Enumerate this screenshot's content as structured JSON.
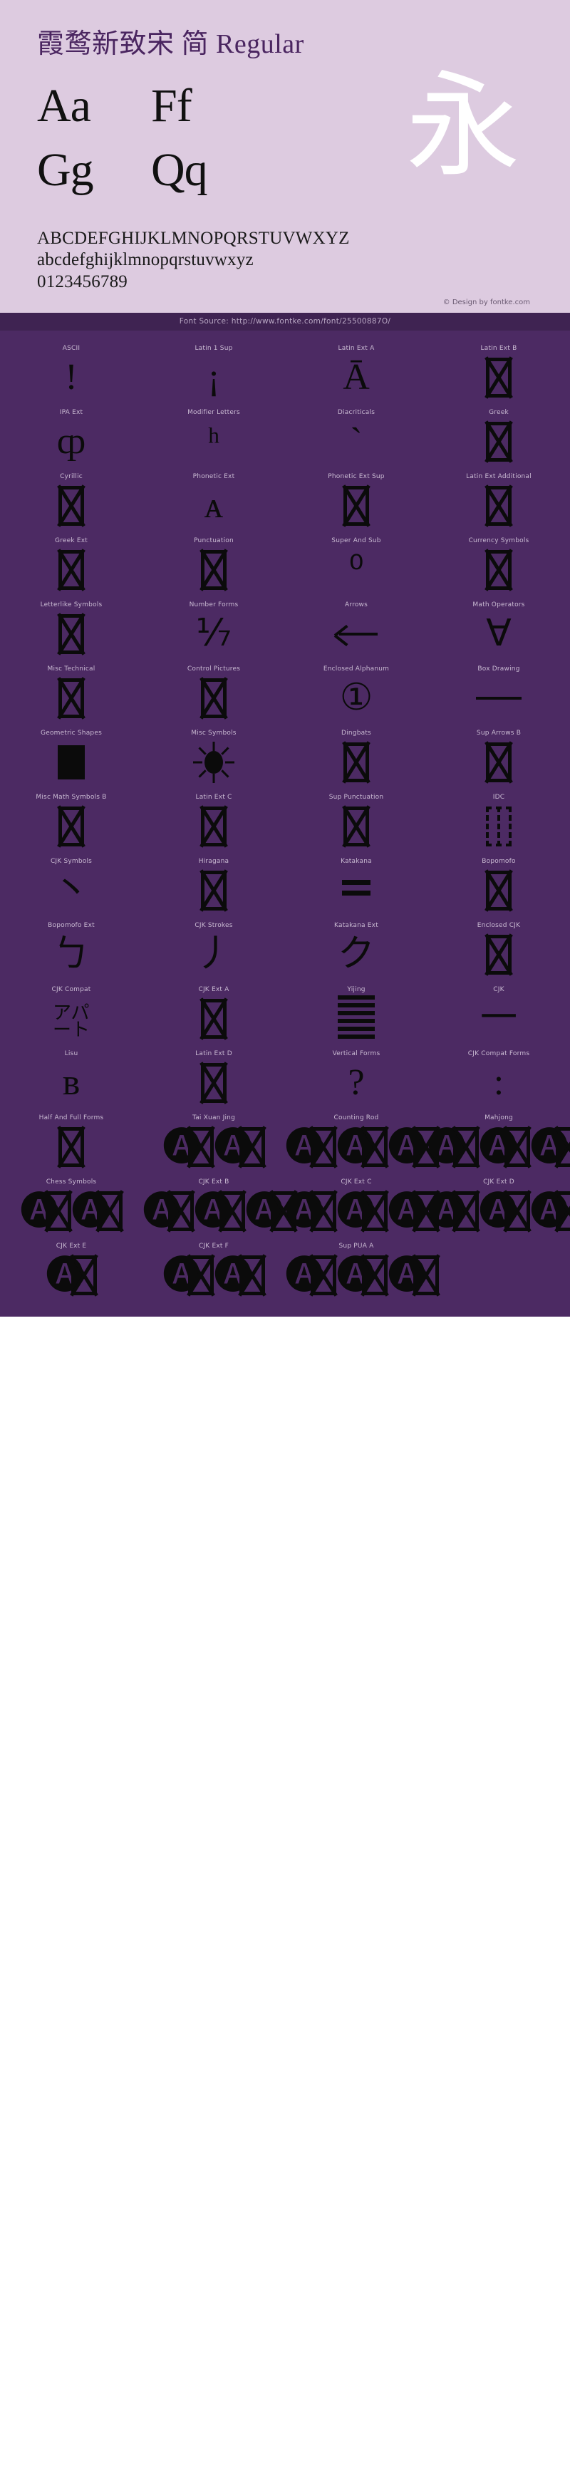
{
  "header": {
    "font_title": "霞鹜新致宋 简 Regular",
    "sample_pairs": [
      "Aa",
      "Ff",
      "Gg",
      "Qq"
    ],
    "cjk_showcase_glyph": "永",
    "uppercase_line": "ABCDEFGHIJKLMNOPQRSTUVWXYZ",
    "lowercase_line": "abcdefghijklmnopqrstuvwxyz",
    "digits_line": "0123456789",
    "design_credit": "© Design by fontke.com",
    "font_source": "Font Source: http://www.fontke.com/font/25500887O/"
  },
  "colors": {
    "specimen_background": "#ddcbe0",
    "title_color": "#4a2560",
    "grid_background": "#4c2a63",
    "source_bar_background": "#3f2352",
    "glyph_color": "#0b0b0b",
    "label_color": "#c9bad2"
  },
  "unicode_blocks": [
    {
      "label": "ASCII",
      "sample": "!"
    },
    {
      "label": "Latin 1 Sup",
      "sample": "¡"
    },
    {
      "label": "Latin Ext A",
      "sample": "Ā"
    },
    {
      "label": "Latin Ext B",
      "sample": "tofu"
    },
    {
      "label": "IPA Ext",
      "sample": "ȹ"
    },
    {
      "label": "Modifier Letters",
      "sample": "ʰ"
    },
    {
      "label": "Diacriticals",
      "sample": "`"
    },
    {
      "label": "Greek",
      "sample": "tofu"
    },
    {
      "label": "Cyrillic",
      "sample": "tofu"
    },
    {
      "label": "Phonetic Ext",
      "sample": "ᴀ"
    },
    {
      "label": "Phonetic Ext Sup",
      "sample": "tofu"
    },
    {
      "label": "Latin Ext Additional",
      "sample": "tofu"
    },
    {
      "label": "Greek Ext",
      "sample": "tofu"
    },
    {
      "label": "Punctuation",
      "sample": "tofu"
    },
    {
      "label": "Super And Sub",
      "sample": "⁰"
    },
    {
      "label": "Currency Symbols",
      "sample": "tofu"
    },
    {
      "label": "Letterlike Symbols",
      "sample": "tofu"
    },
    {
      "label": "Number Forms",
      "sample": "⅐"
    },
    {
      "label": "Arrows",
      "sample": "arrow-left"
    },
    {
      "label": "Math Operators",
      "sample": "∀"
    },
    {
      "label": "Misc Technical",
      "sample": "tofu"
    },
    {
      "label": "Control Pictures",
      "sample": "tofu"
    },
    {
      "label": "Enclosed Alphanum",
      "sample": "①"
    },
    {
      "label": "Box Drawing",
      "sample": "bar"
    },
    {
      "label": "Geometric Shapes",
      "sample": "solid-square"
    },
    {
      "label": "Misc Symbols",
      "sample": "sun"
    },
    {
      "label": "Dingbats",
      "sample": "tofu"
    },
    {
      "label": "Sup Arrows B",
      "sample": "tofu"
    },
    {
      "label": "Misc Math Symbols B",
      "sample": "tofu"
    },
    {
      "label": "Latin Ext C",
      "sample": "tofu"
    },
    {
      "label": "Sup Punctuation",
      "sample": "tofu"
    },
    {
      "label": "IDC",
      "sample": "tofu-dashed"
    },
    {
      "label": "CJK Symbols",
      "sample": "丶"
    },
    {
      "label": "Hiragana",
      "sample": "tofu"
    },
    {
      "label": "Katakana",
      "sample": "dbl-eq"
    },
    {
      "label": "Bopomofo",
      "sample": "tofu"
    },
    {
      "label": "Bopomofo Ext",
      "sample": "ㄅ"
    },
    {
      "label": "CJK Strokes",
      "sample": "丿"
    },
    {
      "label": "Katakana Ext",
      "sample": "ク"
    },
    {
      "label": "Enclosed CJK",
      "sample": "tofu"
    },
    {
      "label": "CJK Compat",
      "sample": "アパート"
    },
    {
      "label": "CJK Ext A",
      "sample": "tofu"
    },
    {
      "label": "Yijing",
      "sample": "hexagram"
    },
    {
      "label": "CJK",
      "sample": "一"
    },
    {
      "label": "Lisu",
      "sample": "ʙ"
    },
    {
      "label": "Latin Ext D",
      "sample": "tofu"
    },
    {
      "label": "Vertical Forms",
      "sample": "?"
    },
    {
      "label": "CJK Compat Forms",
      "sample": ":"
    },
    {
      "label": "Half And Full Forms",
      "sample": "tofu"
    },
    {
      "label": "Tai Xuan Jing",
      "sample": "cluster-2"
    },
    {
      "label": "Counting Rod",
      "sample": "cluster-3"
    },
    {
      "label": "Mahjong",
      "sample": "cluster-4"
    },
    {
      "label": "Chess Symbols",
      "sample": "cluster-2"
    },
    {
      "label": "CJK Ext B",
      "sample": "cluster-3"
    },
    {
      "label": "CJK Ext C",
      "sample": "cluster-3"
    },
    {
      "label": "CJK Ext D",
      "sample": "cluster-3"
    },
    {
      "label": "CJK Ext E",
      "sample": "cluster-1"
    },
    {
      "label": "CJK Ext F",
      "sample": "cluster-2"
    },
    {
      "label": "Sup PUA A",
      "sample": "cluster-3"
    },
    {
      "label": "",
      "sample": ""
    }
  ]
}
